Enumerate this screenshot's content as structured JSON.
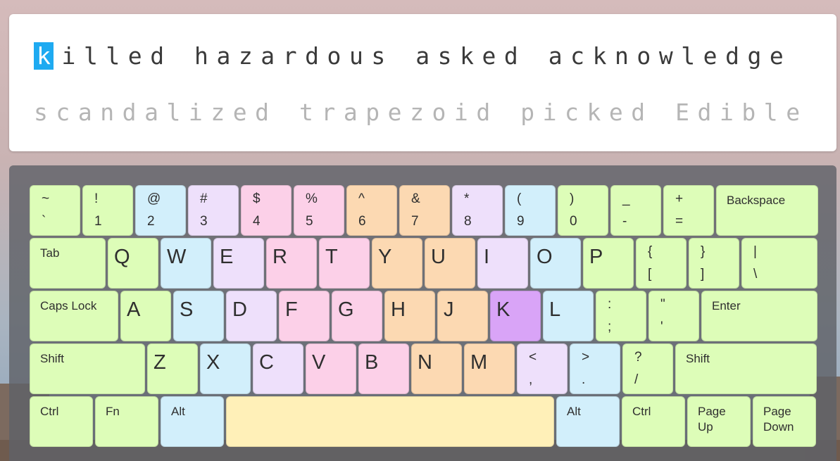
{
  "typing": {
    "current_char": "k",
    "line1_rest": "illed hazardous asked acknowledge",
    "line2": "scandalized trapezoid picked Edible"
  },
  "keyboard": {
    "row1": [
      {
        "top": "~",
        "bottom": "`",
        "color": "green"
      },
      {
        "top": "!",
        "bottom": "1",
        "color": "green"
      },
      {
        "top": "@",
        "bottom": "2",
        "color": "blue"
      },
      {
        "top": "#",
        "bottom": "3",
        "color": "lavender"
      },
      {
        "top": "$",
        "bottom": "4",
        "color": "pink"
      },
      {
        "top": "%",
        "bottom": "5",
        "color": "pink"
      },
      {
        "top": "^",
        "bottom": "6",
        "color": "orange"
      },
      {
        "top": "&",
        "bottom": "7",
        "color": "orange"
      },
      {
        "top": "*",
        "bottom": "8",
        "color": "lavender"
      },
      {
        "top": "(",
        "bottom": "9",
        "color": "blue"
      },
      {
        "top": ")",
        "bottom": "0",
        "color": "green"
      },
      {
        "top": "_",
        "bottom": "-",
        "color": "green"
      },
      {
        "top": "+",
        "bottom": "=",
        "color": "green"
      },
      {
        "label": "Backspace",
        "color": "green"
      }
    ],
    "row2": [
      {
        "label": "Tab",
        "color": "green"
      },
      {
        "letter": "Q",
        "color": "green"
      },
      {
        "letter": "W",
        "color": "blue"
      },
      {
        "letter": "E",
        "color": "lavender"
      },
      {
        "letter": "R",
        "color": "pink"
      },
      {
        "letter": "T",
        "color": "pink"
      },
      {
        "letter": "Y",
        "color": "orange"
      },
      {
        "letter": "U",
        "color": "orange"
      },
      {
        "letter": "I",
        "color": "lavender"
      },
      {
        "letter": "O",
        "color": "blue"
      },
      {
        "letter": "P",
        "color": "green"
      },
      {
        "top": "{",
        "bottom": "[",
        "color": "green"
      },
      {
        "top": "}",
        "bottom": "]",
        "color": "green"
      },
      {
        "top": "|",
        "bottom": "\\",
        "color": "green"
      }
    ],
    "row3": [
      {
        "label": "Caps Lock",
        "color": "green"
      },
      {
        "letter": "A",
        "color": "green"
      },
      {
        "letter": "S",
        "color": "blue"
      },
      {
        "letter": "D",
        "color": "lavender"
      },
      {
        "letter": "F",
        "color": "pink"
      },
      {
        "letter": "G",
        "color": "pink"
      },
      {
        "letter": "H",
        "color": "orange"
      },
      {
        "letter": "J",
        "color": "orange"
      },
      {
        "letter": "K",
        "color": "active"
      },
      {
        "letter": "L",
        "color": "blue"
      },
      {
        "top": ":",
        "bottom": ";",
        "color": "green"
      },
      {
        "top": "\"",
        "bottom": "'",
        "color": "green"
      },
      {
        "label": "Enter",
        "color": "green"
      }
    ],
    "row4": [
      {
        "label": "Shift",
        "color": "green"
      },
      {
        "letter": "Z",
        "color": "green"
      },
      {
        "letter": "X",
        "color": "blue"
      },
      {
        "letter": "C",
        "color": "lavender"
      },
      {
        "letter": "V",
        "color": "pink"
      },
      {
        "letter": "B",
        "color": "pink"
      },
      {
        "letter": "N",
        "color": "orange"
      },
      {
        "letter": "M",
        "color": "orange"
      },
      {
        "top": "<",
        "bottom": ",",
        "color": "lavender"
      },
      {
        "top": ">",
        "bottom": ".",
        "color": "blue"
      },
      {
        "top": "?",
        "bottom": "/",
        "color": "green"
      },
      {
        "label": "Shift",
        "color": "green"
      }
    ],
    "row5": [
      {
        "label": "Ctrl",
        "color": "green"
      },
      {
        "label": "Fn",
        "color": "green"
      },
      {
        "label": "Alt",
        "color": "blue"
      },
      {
        "label": "",
        "color": "yellow"
      },
      {
        "label": "Alt",
        "color": "blue"
      },
      {
        "label": "Ctrl",
        "color": "green"
      },
      {
        "label": "Page Up",
        "color": "green"
      },
      {
        "label": "Page Down",
        "color": "green"
      }
    ]
  }
}
